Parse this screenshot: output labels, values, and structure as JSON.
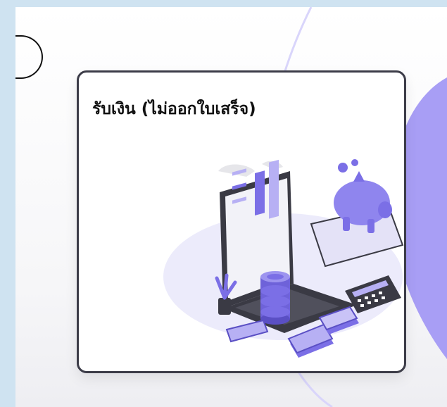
{
  "card": {
    "title": "รับเงิน (ไม่ออกใบเสร็จ)",
    "illustration": "finance-illustration"
  },
  "colors": {
    "page_background": "#cfe3f1",
    "accent_purple": "#7b6fe6",
    "light_purple": "#b7b0f4",
    "dark": "#3a3a44"
  }
}
